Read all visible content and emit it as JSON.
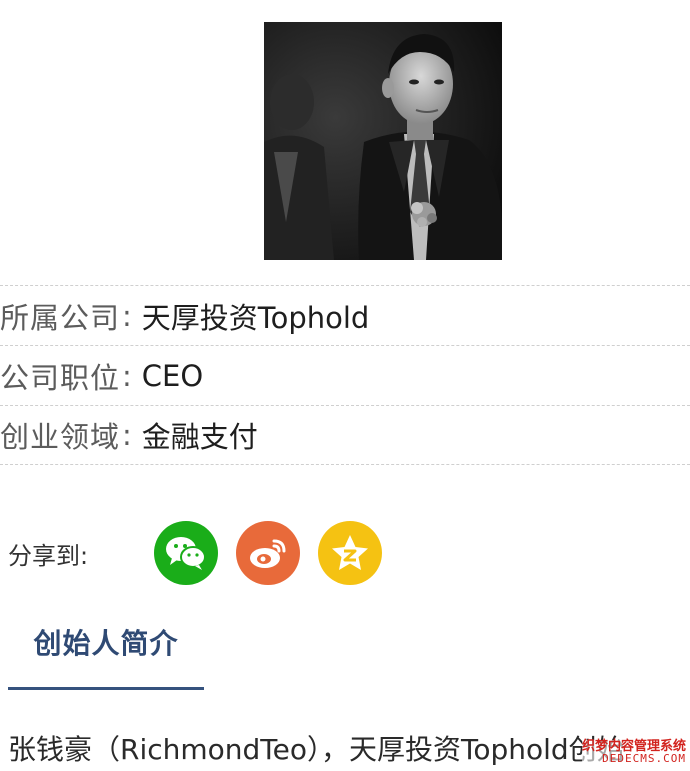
{
  "profile": {
    "photo_alt": "founder portrait"
  },
  "info": {
    "rows": [
      {
        "label": "所属公司",
        "colon": ":",
        "value": "天厚投资Tophold"
      },
      {
        "label": "公司职位",
        "colon": ":",
        "value": "CEO"
      },
      {
        "label": "创业领域",
        "colon": ":",
        "value": "金融支付"
      }
    ]
  },
  "share": {
    "label": "分享到:",
    "buttons": [
      {
        "name": "wechat",
        "icon": "wechat-icon",
        "color": "#1aad19"
      },
      {
        "name": "weibo",
        "icon": "weibo-icon",
        "color": "#e86a3a"
      },
      {
        "name": "qzone",
        "icon": "qzone-icon",
        "color": "#f5c212"
      }
    ]
  },
  "section": {
    "tab_label": "创始人简介"
  },
  "intro": {
    "text": "张钱豪（RichmondTeo），天厚投资Tophold创始"
  },
  "watermark": {
    "cn": "织梦内容管理系统",
    "en": "DEDECMS.COM"
  },
  "colors": {
    "accent": "#35527e",
    "tab_text": "#2f4a74",
    "wechat": "#1aad19",
    "weibo": "#e86a3a",
    "qzone": "#f5c212"
  }
}
